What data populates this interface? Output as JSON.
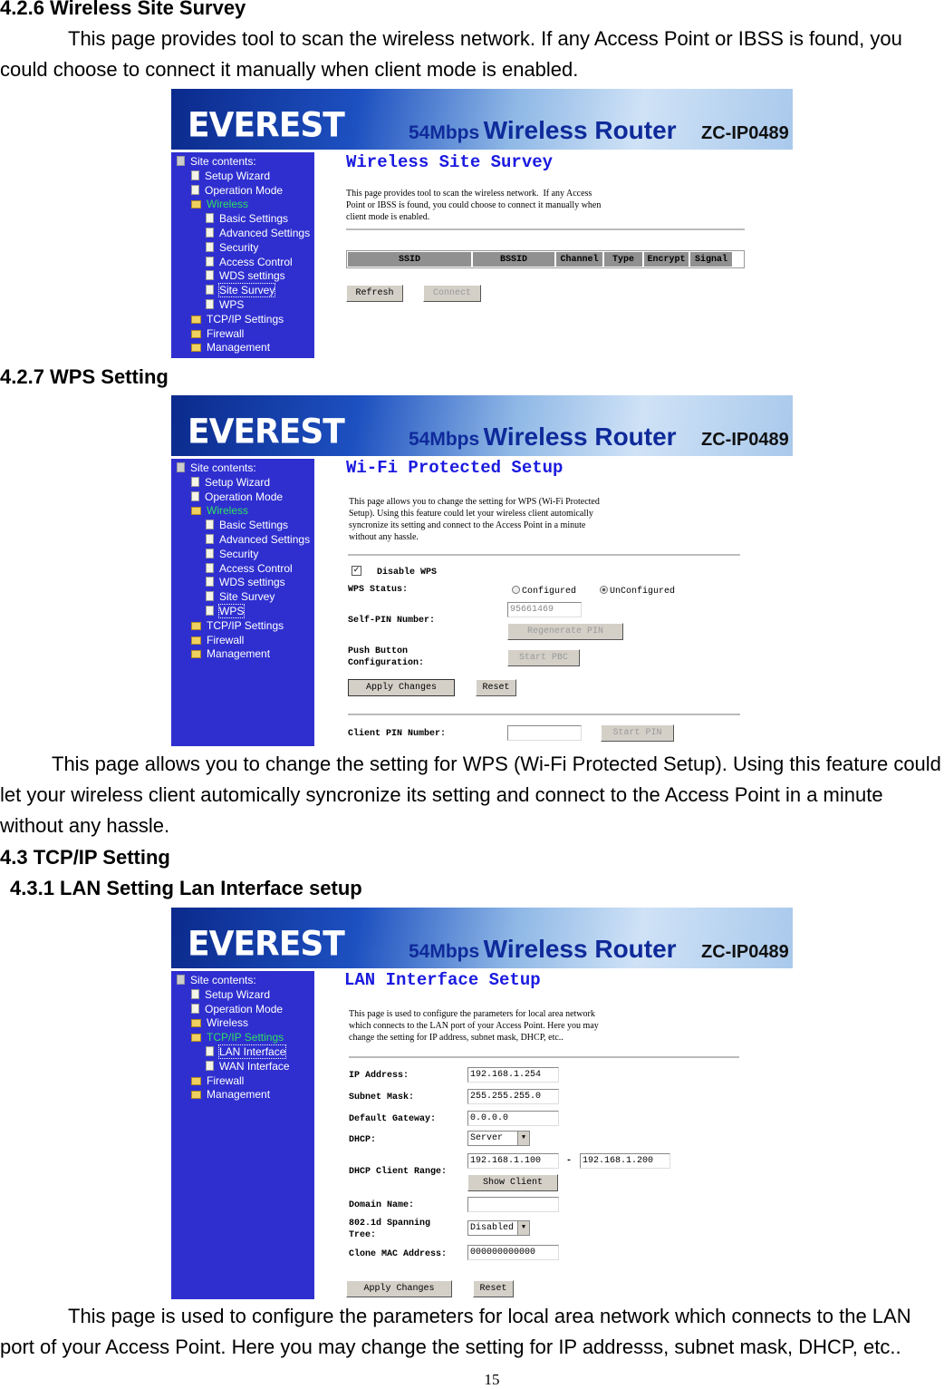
{
  "banner": {
    "logo": "EVEREST",
    "speed": "54Mbps",
    "title": "Wireless Router",
    "model": "ZC-IP0489",
    "colors": {
      "banner_dark": "#0b2a8c",
      "sidebar": "#2f2fd0",
      "title": "#1a1ae0"
    }
  },
  "s426": {
    "heading": "4.2.6 Wireless Site Survey",
    "para": "This page provides tool to scan the wireless network. If any Access Point or IBSS is found, you could choose to connect it manually when client mode is enabled.",
    "shot": {
      "title": "Wireless Site Survey",
      "desc": "This page provides tool to scan the wireless network.  If any Access\nPoint or IBSS is found, you could choose to connect it manually when\nclient mode is enabled.",
      "columns": [
        "SSID",
        "BSSID",
        "Channel",
        "Type",
        "Encrypt",
        "Signal"
      ],
      "refresh": "Refresh",
      "connect": "Connect",
      "sidebar": [
        {
          "label": "Site contents:",
          "lvl": 0,
          "icon": "network"
        },
        {
          "label": "Setup Wizard",
          "lvl": 1,
          "icon": "page"
        },
        {
          "label": "Operation Mode",
          "lvl": 1,
          "icon": "page"
        },
        {
          "label": "Wireless",
          "lvl": 1,
          "icon": "folder-open",
          "open": true
        },
        {
          "label": "Basic Settings",
          "lvl": 2,
          "icon": "page"
        },
        {
          "label": "Advanced Settings",
          "lvl": 2,
          "icon": "page"
        },
        {
          "label": "Security",
          "lvl": 2,
          "icon": "page"
        },
        {
          "label": "Access Control",
          "lvl": 2,
          "icon": "page"
        },
        {
          "label": "WDS settings",
          "lvl": 2,
          "icon": "page"
        },
        {
          "label": "Site Survey",
          "lvl": 2,
          "icon": "page",
          "selected": true
        },
        {
          "label": "WPS",
          "lvl": 2,
          "icon": "page"
        },
        {
          "label": "TCP/IP Settings",
          "lvl": 1,
          "icon": "folder"
        },
        {
          "label": "Firewall",
          "lvl": 1,
          "icon": "folder"
        },
        {
          "label": "Management",
          "lvl": 1,
          "icon": "folder"
        }
      ]
    }
  },
  "s427": {
    "heading": "4.2.7  WPS Setting",
    "para": "This page allows you to change the setting for WPS (Wi-Fi Protected Setup). Using this feature could let your wireless client automically syncronize its setting and connect to the Access Point in a minute without any hassle.",
    "shot": {
      "title": "Wi-Fi Protected Setup",
      "desc": "This page allows you to change the setting for WPS (Wi-Fi Protected\nSetup). Using this feature could let your wireless client automically\nsyncronize its setting and connect to the Access Point in a minute\nwithout any hassle.",
      "disable_wps": "Disable WPS",
      "disable_wps_checked": true,
      "wps_status_label": "WPS Status:",
      "configured": "Configured",
      "unconfigured": "UnConfigured",
      "wps_status_value": "UnConfigured",
      "self_pin_label": "Self-PIN Number:",
      "self_pin_value": "95661469",
      "regenerate": "Regenerate PIN",
      "pbc_label": "Push Button\nConfiguration:",
      "start_pbc": "Start PBC",
      "apply": "Apply Changes",
      "reset": "Reset",
      "client_pin_label": "Client PIN Number:",
      "client_pin_value": "",
      "start_pin": "Start PIN",
      "sidebar": [
        {
          "label": "Site contents:",
          "lvl": 0,
          "icon": "network"
        },
        {
          "label": "Setup Wizard",
          "lvl": 1,
          "icon": "page"
        },
        {
          "label": "Operation Mode",
          "lvl": 1,
          "icon": "page"
        },
        {
          "label": "Wireless",
          "lvl": 1,
          "icon": "folder-open",
          "open": true
        },
        {
          "label": "Basic Settings",
          "lvl": 2,
          "icon": "page"
        },
        {
          "label": "Advanced Settings",
          "lvl": 2,
          "icon": "page"
        },
        {
          "label": "Security",
          "lvl": 2,
          "icon": "page"
        },
        {
          "label": "Access Control",
          "lvl": 2,
          "icon": "page"
        },
        {
          "label": "WDS settings",
          "lvl": 2,
          "icon": "page"
        },
        {
          "label": "Site Survey",
          "lvl": 2,
          "icon": "page"
        },
        {
          "label": "WPS",
          "lvl": 2,
          "icon": "page",
          "selected": true
        },
        {
          "label": "TCP/IP Settings",
          "lvl": 1,
          "icon": "folder"
        },
        {
          "label": "Firewall",
          "lvl": 1,
          "icon": "folder"
        },
        {
          "label": "Management",
          "lvl": 1,
          "icon": "folder"
        }
      ]
    }
  },
  "s43": {
    "heading": "4.3 TCP/IP Setting"
  },
  "s431": {
    "heading": "4.3.1 LAN Setting Lan Interface setup",
    "para": "This page is used to configure the parameters for local area network which connects to the LAN port of your Access Point. Here you may change the setting for IP addresss, subnet mask, DHCP, etc..",
    "shot": {
      "title": "LAN Interface Setup",
      "desc": "This page is used to configure the parameters for local area network\nwhich connects to the LAN port of your Access Point. Here you may\nchange the setting for IP address, subnet mask, DHCP, etc..",
      "ip_label": "IP Address:",
      "ip": "192.168.1.254",
      "mask_label": "Subnet Mask:",
      "mask": "255.255.255.0",
      "gw_label": "Default Gateway:",
      "gw": "0.0.0.0",
      "dhcp_label": "DHCP:",
      "dhcp": "Server",
      "range_label": "DHCP Client Range:",
      "range_start": "192.168.1.100",
      "range_sep": "-",
      "range_end": "192.168.1.200",
      "show_client": "Show Client",
      "domain_label": "Domain Name:",
      "domain": "",
      "stp_label": "802.1d Spanning\nTree:",
      "stp": "Disabled",
      "mac_label": "Clone MAC Address:",
      "mac": "000000000000",
      "apply": "Apply Changes",
      "reset": "Reset",
      "sidebar": [
        {
          "label": "Site contents:",
          "lvl": 0,
          "icon": "network"
        },
        {
          "label": "Setup Wizard",
          "lvl": 1,
          "icon": "page"
        },
        {
          "label": "Operation Mode",
          "lvl": 1,
          "icon": "page"
        },
        {
          "label": "Wireless",
          "lvl": 1,
          "icon": "folder"
        },
        {
          "label": "TCP/IP Settings",
          "lvl": 1,
          "icon": "folder-open",
          "open": true
        },
        {
          "label": "LAN Interface",
          "lvl": 2,
          "icon": "page",
          "selected": true
        },
        {
          "label": "WAN Interface",
          "lvl": 2,
          "icon": "page"
        },
        {
          "label": "Firewall",
          "lvl": 1,
          "icon": "folder"
        },
        {
          "label": "Management",
          "lvl": 1,
          "icon": "folder"
        }
      ]
    }
  },
  "page_number": "15"
}
